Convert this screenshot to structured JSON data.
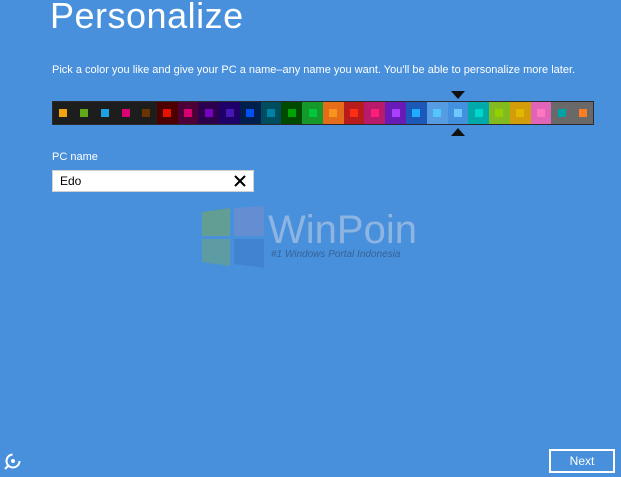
{
  "page": {
    "title": "Personalize",
    "subtitle": "Pick a color you like and give your PC a name–any name you want. You'll be able to personalize more later.",
    "background_color": "#4890dc"
  },
  "palette": {
    "selected_index": 19,
    "swatches": [
      {
        "bg": "#1d1d1d",
        "chip": "#f0a30a"
      },
      {
        "bg": "#1d1d1d",
        "chip": "#60a917"
      },
      {
        "bg": "#1d1d1d",
        "chip": "#1ba1e2"
      },
      {
        "bg": "#1d1d1d",
        "chip": "#d80073"
      },
      {
        "bg": "#1d1d1d",
        "chip": "#6a3300"
      },
      {
        "bg": "#4e0000",
        "chip": "#e51400"
      },
      {
        "bg": "#4e0038",
        "chip": "#d8006f"
      },
      {
        "bg": "#2d004e",
        "chip": "#7a00c0"
      },
      {
        "bg": "#1f0068",
        "chip": "#4617b4"
      },
      {
        "bg": "#001e4e",
        "chip": "#0050ef"
      },
      {
        "bg": "#004d60",
        "chip": "#0082a6"
      },
      {
        "bg": "#004a00",
        "chip": "#00a300"
      },
      {
        "bg": "#15992a",
        "chip": "#00c63c"
      },
      {
        "bg": "#e56c19",
        "chip": "#f7941d"
      },
      {
        "bg": "#b81b1b",
        "chip": "#ff2e12"
      },
      {
        "bg": "#b81b6c",
        "chip": "#ff1d77"
      },
      {
        "bg": "#691bb8",
        "chip": "#aa40ff"
      },
      {
        "bg": "#1b58b8",
        "chip": "#1faeff"
      },
      {
        "bg": "#569ce3",
        "chip": "#56c5ff"
      },
      {
        "bg": "#4390df",
        "chip": "#6ec6ff"
      },
      {
        "bg": "#00aaaa",
        "chip": "#00d8cc"
      },
      {
        "bg": "#83ba1f",
        "chip": "#91d100"
      },
      {
        "bg": "#d39d09",
        "chip": "#e1b700"
      },
      {
        "bg": "#e064b7",
        "chip": "#ff76bc"
      },
      {
        "bg": "#696969",
        "chip": "#00a3a3"
      },
      {
        "bg": "#696969",
        "chip": "#fe7c22"
      }
    ]
  },
  "pc_name": {
    "label": "PC name",
    "value": "Edo",
    "clear_icon": "close-icon"
  },
  "watermark": {
    "name": "WinPoin",
    "tagline": "#1 Windows Portal Indonesia",
    "logo_icon": "windows-logo-icon"
  },
  "footer": {
    "ease_of_access_icon": "ease-of-access-icon",
    "next_label": "Next"
  }
}
